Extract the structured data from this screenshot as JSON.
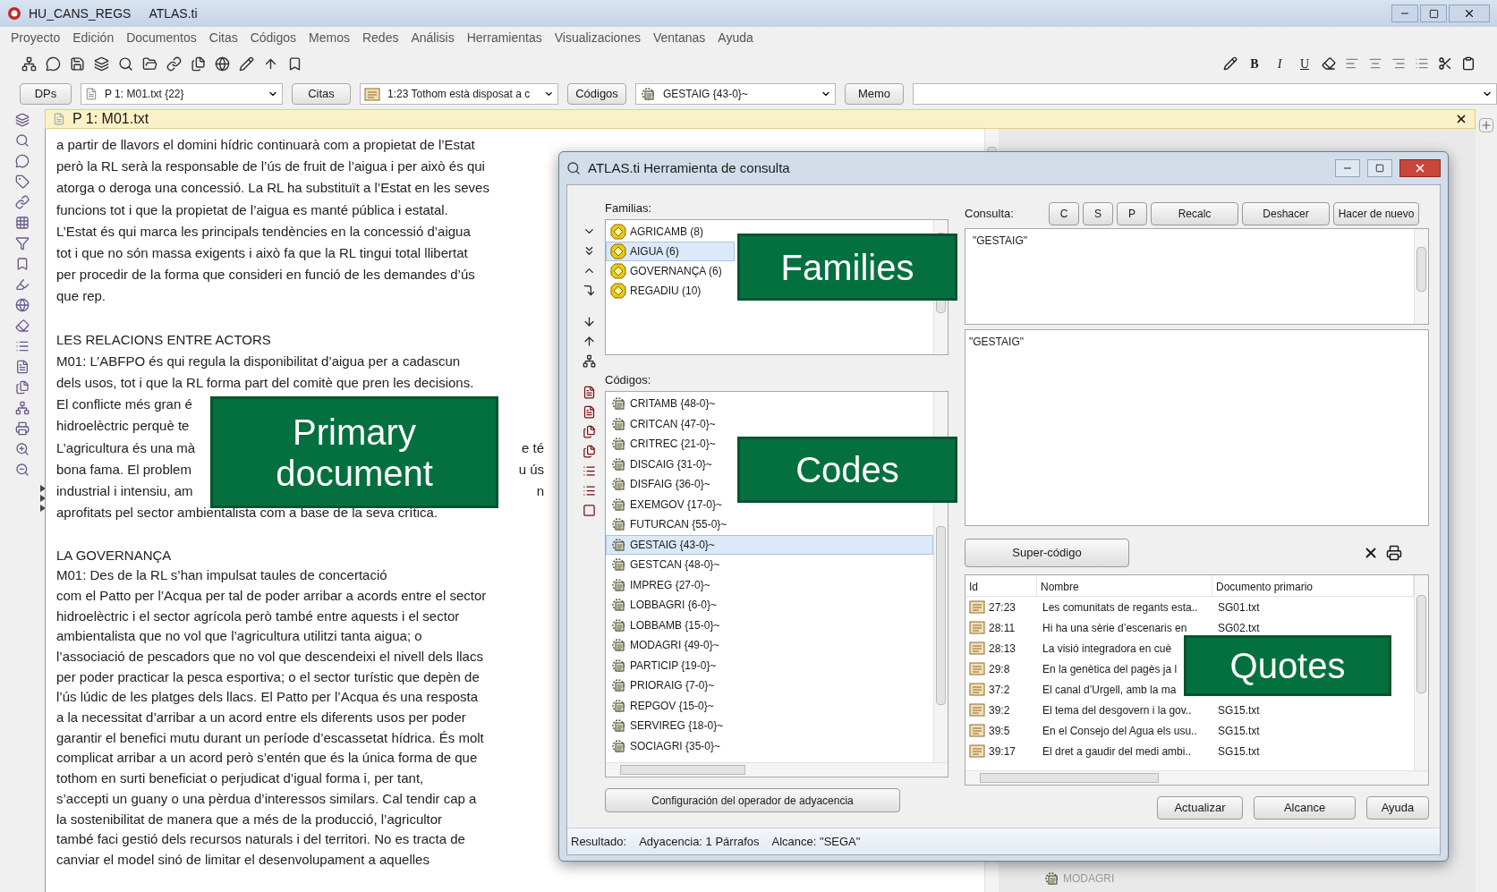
{
  "window": {
    "title": "HU_CANS_REGS",
    "app": "ATLAS.ti"
  },
  "menu": [
    "Proyecto",
    "Edición",
    "Documentos",
    "Citas",
    "Códigos",
    "Memos",
    "Redes",
    "Análisis",
    "Herramientas",
    "Visualizaciones",
    "Ventanas",
    "Ayuda"
  ],
  "format_buttons": [
    "B",
    "I",
    "U"
  ],
  "selector_bar": [
    {
      "kind": "button",
      "label": "DPs"
    },
    {
      "kind": "dropdown",
      "value": "P 1: M01.txt {22}"
    },
    {
      "kind": "button",
      "label": "Citas"
    },
    {
      "kind": "dropdown",
      "value": "1:23 Tothom està disposat a c"
    },
    {
      "kind": "button",
      "label": "Códigos"
    },
    {
      "kind": "dropdown",
      "value": "GESTAIG {43-0}~"
    },
    {
      "kind": "button",
      "label": "Memo"
    },
    {
      "kind": "dropdown"
    }
  ],
  "document": {
    "title": "P 1: M01.txt",
    "lines": [
      {
        "kind": "text",
        "text": "a partir de llavors el domini hídric continuarà com a propietat de l’Estat"
      },
      {
        "kind": "text",
        "text": "però la RL serà la responsable de l’ús de fruit de l’aigua i per això és qui"
      },
      {
        "kind": "text",
        "text": "atorga o deroga una concessió. La RL ha substituït a l’Estat en les seves"
      },
      {
        "kind": "text",
        "text": "funcions tot i que la propietat de l’aigua es manté pública i estatal."
      },
      {
        "kind": "text",
        "text": "L’Estat és qui marca les principals tendències en la concessió d’aigua"
      },
      {
        "kind": "text",
        "text": "tot i que no són massa exigents i això fa que la RL tingui total llibertat"
      },
      {
        "kind": "text",
        "text": "per procedir de la forma que consideri en funció de les demandes d’ús"
      },
      {
        "kind": "text",
        "text": "que rep."
      },
      {
        "kind": "blank"
      },
      {
        "kind": "text",
        "text": "LES RELACIONS ENTRE ACTORS"
      },
      {
        "kind": "text",
        "text": "M01: L’ABFPO és qui regula la disponibilitat d’aigua per a cadascun"
      },
      {
        "kind": "text",
        "text": "dels usos, tot i que la RL forma part del comitè que pren les decisions."
      },
      {
        "kind": "text",
        "text": "El conflicte més gran é"
      },
      {
        "kind": "text",
        "text": "hidroelèctric perquè te"
      },
      {
        "kind": "split",
        "left": "L’agricultura és una mà",
        "right": "e té"
      },
      {
        "kind": "split",
        "left": "bona fama. El problem",
        "right": "u ús"
      },
      {
        "kind": "split",
        "left": "industrial i intensiu, am",
        "right": "n"
      },
      {
        "kind": "text",
        "text": "aprofitats pel sector ambientalista com a base de la seva crítica."
      },
      {
        "kind": "blank"
      },
      {
        "kind": "text",
        "text": "LA GOVERNANÇA"
      },
      {
        "kind": "text",
        "text": "M01: Des de la RL s’han impulsat taules de concertació"
      },
      {
        "kind": "text",
        "text": "com el Patto per l’Acqua per tal de poder arribar a acords entre el sector"
      },
      {
        "kind": "text",
        "text": "hidroelèctric i el sector agrícola però també entre aquests i el sector"
      },
      {
        "kind": "text",
        "text": "ambientalista que no vol que l’agricultura utilitzi tanta aigua; o"
      },
      {
        "kind": "text",
        "text": "l’associació de pescadors que no vol que descendeixi el nivell dels llacs"
      },
      {
        "kind": "text",
        "text": "per poder practicar la pesca esportiva; o el sector turístic que depèn de"
      },
      {
        "kind": "text",
        "text": "l’ús lúdic de les platges dels llacs. El Patto per l’Acqua és una resposta"
      },
      {
        "kind": "text",
        "text": "a la necessitat d’arribar a un acord entre els diferents usos per poder"
      },
      {
        "kind": "text",
        "text": "garantir el benefici mutu durant un període d’escassetat hídrica. És molt"
      },
      {
        "kind": "text",
        "text": "complicat arribar a un acord però s’entén que és la única forma de que"
      },
      {
        "kind": "text",
        "text": "tothom en surti beneficiat o perjudicat d’igual forma i, per tant,"
      },
      {
        "kind": "text",
        "text": "s’accepti un guany o una pèrdua d’interessos similars. Cal tendir cap a"
      },
      {
        "kind": "text",
        "text": "la sostenibilitat de manera que a més de la producció, l’agricultor"
      },
      {
        "kind": "text",
        "text": "també faci gestió dels recursos naturals i del territori. No es tracta de"
      },
      {
        "kind": "text",
        "text": "canviar el model sinó de limitar el desenvolupament a aquelles"
      }
    ]
  },
  "background_codes": [
    "MODAGRI"
  ],
  "dialog": {
    "title": "ATLAS.ti Herramienta de consulta",
    "families_label": "Familias:",
    "families": [
      {
        "name": "AGRICAMB (8)",
        "selected": false
      },
      {
        "name": "AIGUA (6)",
        "selected": true
      },
      {
        "name": "GOVERNANÇA (6)",
        "selected": false
      },
      {
        "name": "REGADIU (10)",
        "selected": false
      }
    ],
    "codes_label": "Códigos:",
    "codes": [
      {
        "name": "CRITAMB {48-0}~",
        "selected": false
      },
      {
        "name": "CRITCAN {47-0}~",
        "selected": false
      },
      {
        "name": "CRITREC {21-0}~",
        "selected": false
      },
      {
        "name": "DISCAIG {31-0}~",
        "selected": false
      },
      {
        "name": "DISFAIG {36-0}~",
        "selected": false
      },
      {
        "name": "EXEMGOV {17-0}~",
        "selected": false
      },
      {
        "name": "FUTURCAN {55-0}~",
        "selected": false
      },
      {
        "name": "GESTAIG {43-0}~",
        "selected": true
      },
      {
        "name": "GESTCAN {48-0}~",
        "selected": false
      },
      {
        "name": "IMPREG {27-0}~",
        "selected": false
      },
      {
        "name": "LOBBAGRI {6-0}~",
        "selected": false
      },
      {
        "name": "LOBBAMB {15-0}~",
        "selected": false
      },
      {
        "name": "MODAGRI {49-0}~",
        "selected": false
      },
      {
        "name": "PARTICIP {19-0}~",
        "selected": false
      },
      {
        "name": "PRIORAIG {7-0}~",
        "selected": false
      },
      {
        "name": "REPGOV {15-0}~",
        "selected": false
      },
      {
        "name": "SERVIREG {18-0}~",
        "selected": false
      },
      {
        "name": "SOCIAGRI {35-0}~",
        "selected": false
      }
    ],
    "config_button": "Configuración del operador de adyacencia",
    "query_label": "Consulta:",
    "query_buttons": [
      "C",
      "S",
      "P",
      "Recalc",
      "Deshacer",
      "Hacer de nuevo"
    ],
    "query_text": "\"GESTAIG\"",
    "result_text": "\"GESTAIG\"",
    "supercode_button": "Super-código",
    "quotes": {
      "columns": [
        "Id",
        "Nombre",
        "Documento primario"
      ],
      "rows": [
        [
          "27:23",
          "Les comunitats de regants esta..",
          "SG01.txt"
        ],
        [
          "28:11",
          "Hi ha una sèrie d’escenaris en",
          "SG02.txt"
        ],
        [
          "28:13",
          "La visió integradora en cuè",
          ""
        ],
        [
          "29:8",
          "En la genètica del pagès ja l",
          ""
        ],
        [
          "37:2",
          "El canal d’Urgell, amb la ma",
          ""
        ],
        [
          "39:2",
          "El tema del desgovern i la gov..",
          "SG15.txt"
        ],
        [
          "39:5",
          "En el Consejo del Agua els usu..",
          "SG15.txt"
        ],
        [
          "39:17",
          "El dret a gaudir del medi ambi..",
          "SG15.txt"
        ]
      ]
    },
    "bottom_buttons": [
      "Actualizar",
      "Alcance",
      "Ayuda"
    ],
    "status": [
      "Resultado:",
      "Adyacencia: 1 Párrafos",
      "Alcance: \"SEGA\""
    ]
  },
  "annotations": [
    {
      "text": "Primary document"
    },
    {
      "text": "Families"
    },
    {
      "text": "Codes"
    },
    {
      "text": "Quotes"
    }
  ]
}
